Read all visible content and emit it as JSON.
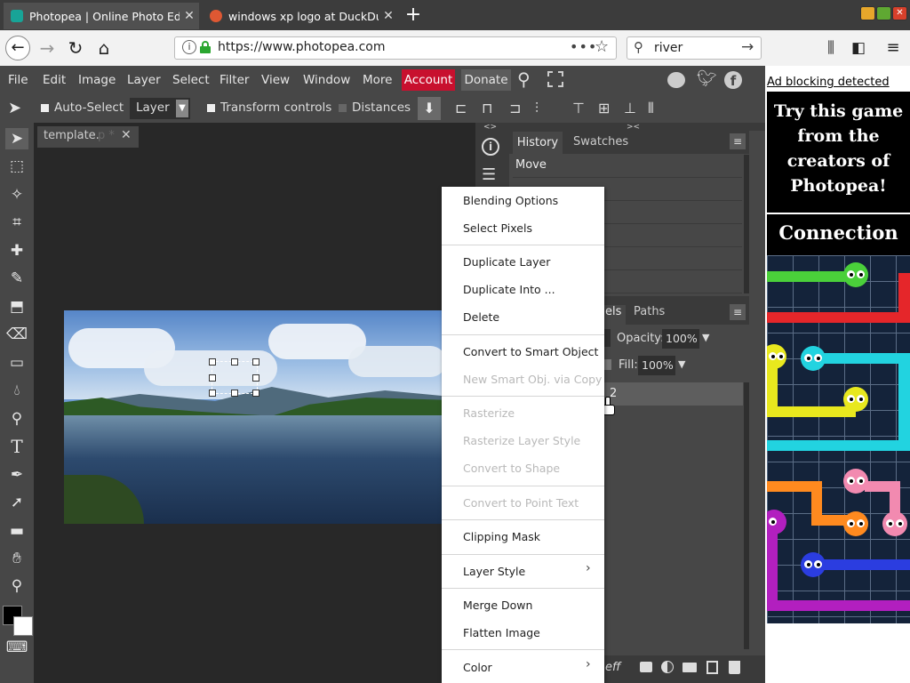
{
  "browser": {
    "tabs": [
      {
        "title": "Photopea | Online Photo Edit",
        "favicon_color": "#18a497"
      },
      {
        "title": "windows xp logo at DuckDuc",
        "favicon_color": "#de5833"
      }
    ],
    "url": "https://www.photopea.com",
    "search_value": "river"
  },
  "menu": {
    "items": [
      "File",
      "Edit",
      "Image",
      "Layer",
      "Select",
      "Filter",
      "View",
      "Window",
      "More"
    ],
    "account": "Account",
    "donate": "Donate"
  },
  "options": {
    "auto_select": "Auto-Select",
    "layer_select": "Layer",
    "transform_controls": "Transform controls",
    "distances": "Distances"
  },
  "document": {
    "tab_title": "template.",
    "tab_suffix": "p *"
  },
  "panels": {
    "history_tab": "History",
    "swatches_tab": "Swatches",
    "history_first": "Move",
    "layers_tab_partial": "els",
    "paths_tab": "Paths",
    "opacity_label": "Opacity:",
    "opacity_value": "100%",
    "fill_label": "Fill:",
    "fill_value": "100%",
    "layer_name_partial": "2",
    "bottom_fx": "eff"
  },
  "context_menu": {
    "items": [
      {
        "label": "Blending Options",
        "enabled": true
      },
      {
        "label": "Select Pixels",
        "enabled": true
      },
      {
        "label": "Duplicate Layer",
        "enabled": true
      },
      {
        "label": "Duplicate Into ...",
        "enabled": true
      },
      {
        "label": "Delete",
        "enabled": true
      },
      {
        "label": "Convert to Smart Object",
        "enabled": true
      },
      {
        "label": "New Smart Obj. via Copy",
        "enabled": false
      },
      {
        "label": "Rasterize",
        "enabled": false
      },
      {
        "label": "Rasterize Layer Style",
        "enabled": false
      },
      {
        "label": "Convert to Shape",
        "enabled": false
      },
      {
        "label": "Convert to Point Text",
        "enabled": false
      },
      {
        "label": "Clipping Mask",
        "enabled": true
      },
      {
        "label": "Layer Style",
        "enabled": true,
        "submenu": true
      },
      {
        "label": "Merge Down",
        "enabled": true
      },
      {
        "label": "Flatten Image",
        "enabled": true
      },
      {
        "label": "Color",
        "enabled": true,
        "submenu": true
      }
    ]
  },
  "ad": {
    "blocking_notice": "Ad blocking detected",
    "headline": "Try this game from the creators of Photopea!",
    "game_title": "Connection"
  },
  "colors": {
    "accent_account": "#c8102e",
    "app_bg": "#474747",
    "canvas_bg": "#282828"
  }
}
